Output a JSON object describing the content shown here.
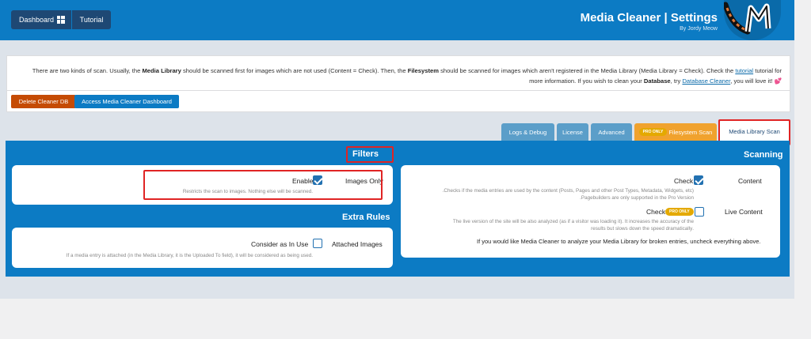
{
  "header": {
    "dashboard_label": "Dashboard",
    "tutorial_label": "Tutorial",
    "title": "Media Cleaner | Settings",
    "subtitle": "By Jordy Meow"
  },
  "notice": {
    "p1": "There are two kinds of scan. Usually, the ",
    "media_library": "Media Library",
    "p2": " should be scanned first for images which are not used (Content = Check). Then, the ",
    "filesystem": "Filesystem",
    "p3": " should be scanned for images which aren't registered in the Media Library (Media Library = Check). Check the ",
    "tutorial_link": "tutorial",
    "p4": " tutorial for",
    "line2_a": "💕 !more information. If you wish to clean your ",
    "database": "Database",
    "line2_b": ", try ",
    "database_cleaner": "Database Cleaner",
    "line2_c": ", you will love it",
    "delete_btn": "Delete Cleaner DB",
    "access_btn": "Access Media Cleaner Dashboard"
  },
  "tabs": {
    "logs": "Logs & Debug",
    "license": "License",
    "advanced": "Advanced",
    "pro_badge": "PRO ONLY",
    "filesystem": "Filesystem Scan",
    "media_library": "Media Library Scan"
  },
  "filters": {
    "title": "Filters",
    "enable_label": "Enable",
    "images_only": "Images Only",
    "images_only_desc": ".Restricts the scan to images. Nothing else will be scanned"
  },
  "extra_rules": {
    "title": "Extra Rules",
    "consider_label": "Consider as In Use",
    "attached_images": "Attached Images",
    "attached_desc": ".If a media entry is attached (in the Media Library, it is the Uploaded To field), it will be considered as being used"
  },
  "scanning": {
    "title": "Scanning",
    "check_label": "Check",
    "content_label": "Content",
    "content_desc_1": "Checks if the media entries are used by the content (Posts, Pages and other Post Types, Metadata, Widgets, etc).",
    "content_desc_2": "Pagebuilders are only supported in the Pro Version.",
    "live_check_label": "Check",
    "pro_only": "PRO ONLY",
    "live_content": "Live Content",
    "live_desc_1": "The live version of the site will be also analyzed (as if a visitor was loading it). It increases the accuracy of the",
    "live_desc_2": ".results but slows down the speed dramatically",
    "broken_note": ".If you would like Media Cleaner to analyze your Media Library for broken entries, uncheck everything above"
  },
  "colors": {
    "brand_blue": "#0c7bc4",
    "dark_blue": "#1e4874",
    "danger": "#c54b04",
    "pro": "#e4a900",
    "highlight_red": "#e02424"
  }
}
